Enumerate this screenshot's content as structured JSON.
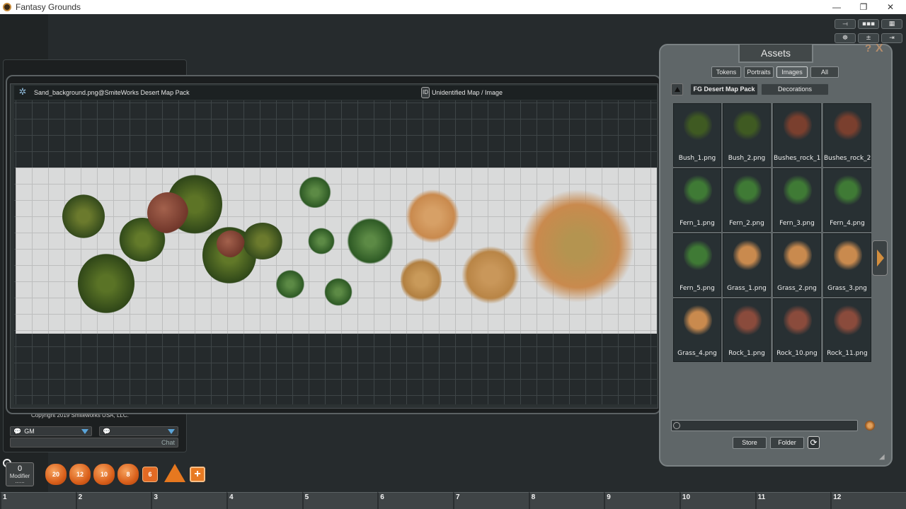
{
  "window": {
    "title": "Fantasy Grounds",
    "controls": [
      "—",
      "❐",
      "✕"
    ]
  },
  "toolbar": {
    "buttons": [
      "⟞",
      "▪▪▪",
      "▦",
      "☸",
      "±",
      "⇥"
    ]
  },
  "image_window": {
    "name": "Sand_background.png@SmiteWorks Desert Map Pack",
    "id_badge": "ID",
    "identity": "Unidentified Map / Image"
  },
  "chat": {
    "copyright": "Copyright 2019 Smiteworks USA, LLC.",
    "speaker": "GM",
    "mode": "",
    "input_placeholder": "Chat"
  },
  "assets": {
    "title": "Assets",
    "help": "?",
    "close": "X",
    "tabs": [
      {
        "label": "Tokens",
        "active": false
      },
      {
        "label": "Portraits",
        "active": false
      },
      {
        "label": "Images",
        "active": true
      },
      {
        "label": "All",
        "active": false
      }
    ],
    "folders": [
      {
        "label": "FG Desert Map Pack",
        "active": true
      },
      {
        "label": "Decorations",
        "active": false
      }
    ],
    "items": [
      {
        "label": "Bush_1.png",
        "kind": "bush"
      },
      {
        "label": "Bush_2.png",
        "kind": "bush"
      },
      {
        "label": "Bushes_rock_1",
        "kind": "bushrock"
      },
      {
        "label": "Bushes_rock_2",
        "kind": "bushrock"
      },
      {
        "label": "Fern_1.png",
        "kind": "fern"
      },
      {
        "label": "Fern_2.png",
        "kind": "fern"
      },
      {
        "label": "Fern_3.png",
        "kind": "fern"
      },
      {
        "label": "Fern_4.png",
        "kind": "fern"
      },
      {
        "label": "Fern_5.png",
        "kind": "fern"
      },
      {
        "label": "Grass_1.png",
        "kind": "grass"
      },
      {
        "label": "Grass_2.png",
        "kind": "grass"
      },
      {
        "label": "Grass_3.png",
        "kind": "grass"
      },
      {
        "label": "Grass_4.png",
        "kind": "grass"
      },
      {
        "label": "Rock_1.png",
        "kind": "rock"
      },
      {
        "label": "Rock_10.png",
        "kind": "rock"
      },
      {
        "label": "Rock_11.png",
        "kind": "rock"
      }
    ],
    "filter_value": "",
    "store_label": "Store",
    "folder_label": "Folder"
  },
  "dice": {
    "modifier_value": "0",
    "modifier_label": "Modifier",
    "modifier_dots": "......",
    "dice": [
      "20",
      "12",
      "10",
      "8",
      "6",
      "",
      "+"
    ]
  },
  "hotkeys": [
    "1",
    "2",
    "3",
    "4",
    "5",
    "6",
    "7",
    "8",
    "9",
    "10",
    "11",
    "12"
  ],
  "colors": {
    "bush": "#3f5a22",
    "bushrock": "#7a3f2e",
    "fern": "#3f7a35",
    "grass": "#c98a4e",
    "rock": "#8a4b3c"
  }
}
